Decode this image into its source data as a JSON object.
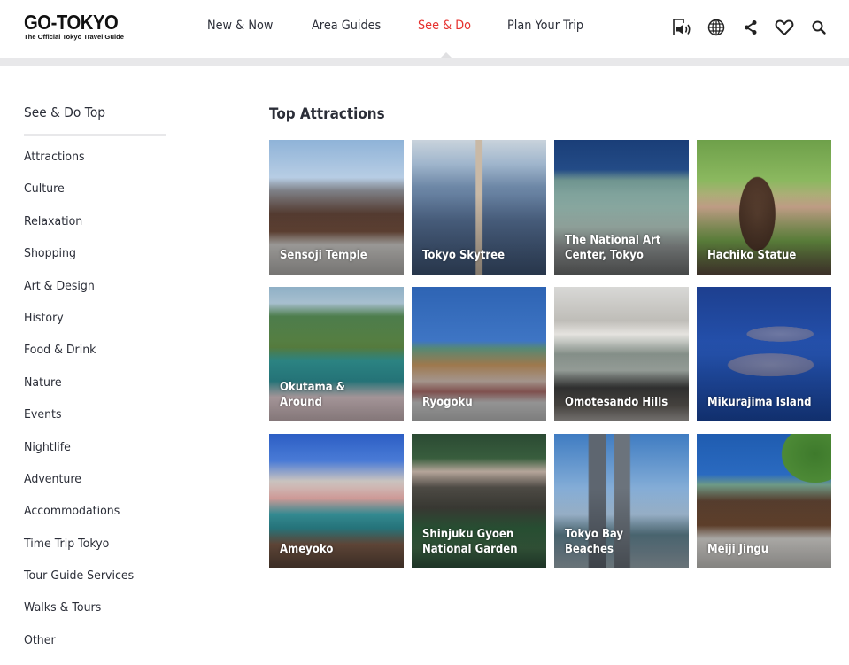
{
  "header": {
    "logo": {
      "main": "GO-TOKYO",
      "tagline": "The Official Tokyo Travel Guide"
    },
    "nav": [
      {
        "label": "New & Now",
        "active": false
      },
      {
        "label": "Area Guides",
        "active": false
      },
      {
        "label": "See & Do",
        "active": true
      },
      {
        "label": "Plan Your Trip",
        "active": false
      }
    ],
    "icons": [
      "audio-reader-icon",
      "globe-icon",
      "share-icon",
      "heart-icon",
      "search-icon"
    ],
    "accent_color": "#e6312e"
  },
  "sidebar": {
    "top_label": "See & Do Top",
    "items": [
      "Attractions",
      "Culture",
      "Relaxation",
      "Shopping",
      "Art & Design",
      "History",
      "Food & Drink",
      "Nature",
      "Events",
      "Nightlife",
      "Adventure",
      "Accommodations",
      "Time Trip Tokyo",
      "Tour Guide Services",
      "Walks & Tours",
      "Other"
    ]
  },
  "main": {
    "title": "Top Attractions",
    "cards": [
      {
        "label": "Sensoji Temple"
      },
      {
        "label": "Tokyo Skytree"
      },
      {
        "label": "The National Art Center, Tokyo"
      },
      {
        "label": "Hachiko Statue"
      },
      {
        "label": "Okutama & Around"
      },
      {
        "label": "Ryogoku"
      },
      {
        "label": "Omotesando Hills"
      },
      {
        "label": "Mikurajima Island"
      },
      {
        "label": "Ameyoko"
      },
      {
        "label": "Shinjuku Gyoen National Garden"
      },
      {
        "label": "Tokyo Bay Beaches"
      },
      {
        "label": "Meiji Jingu"
      }
    ]
  }
}
